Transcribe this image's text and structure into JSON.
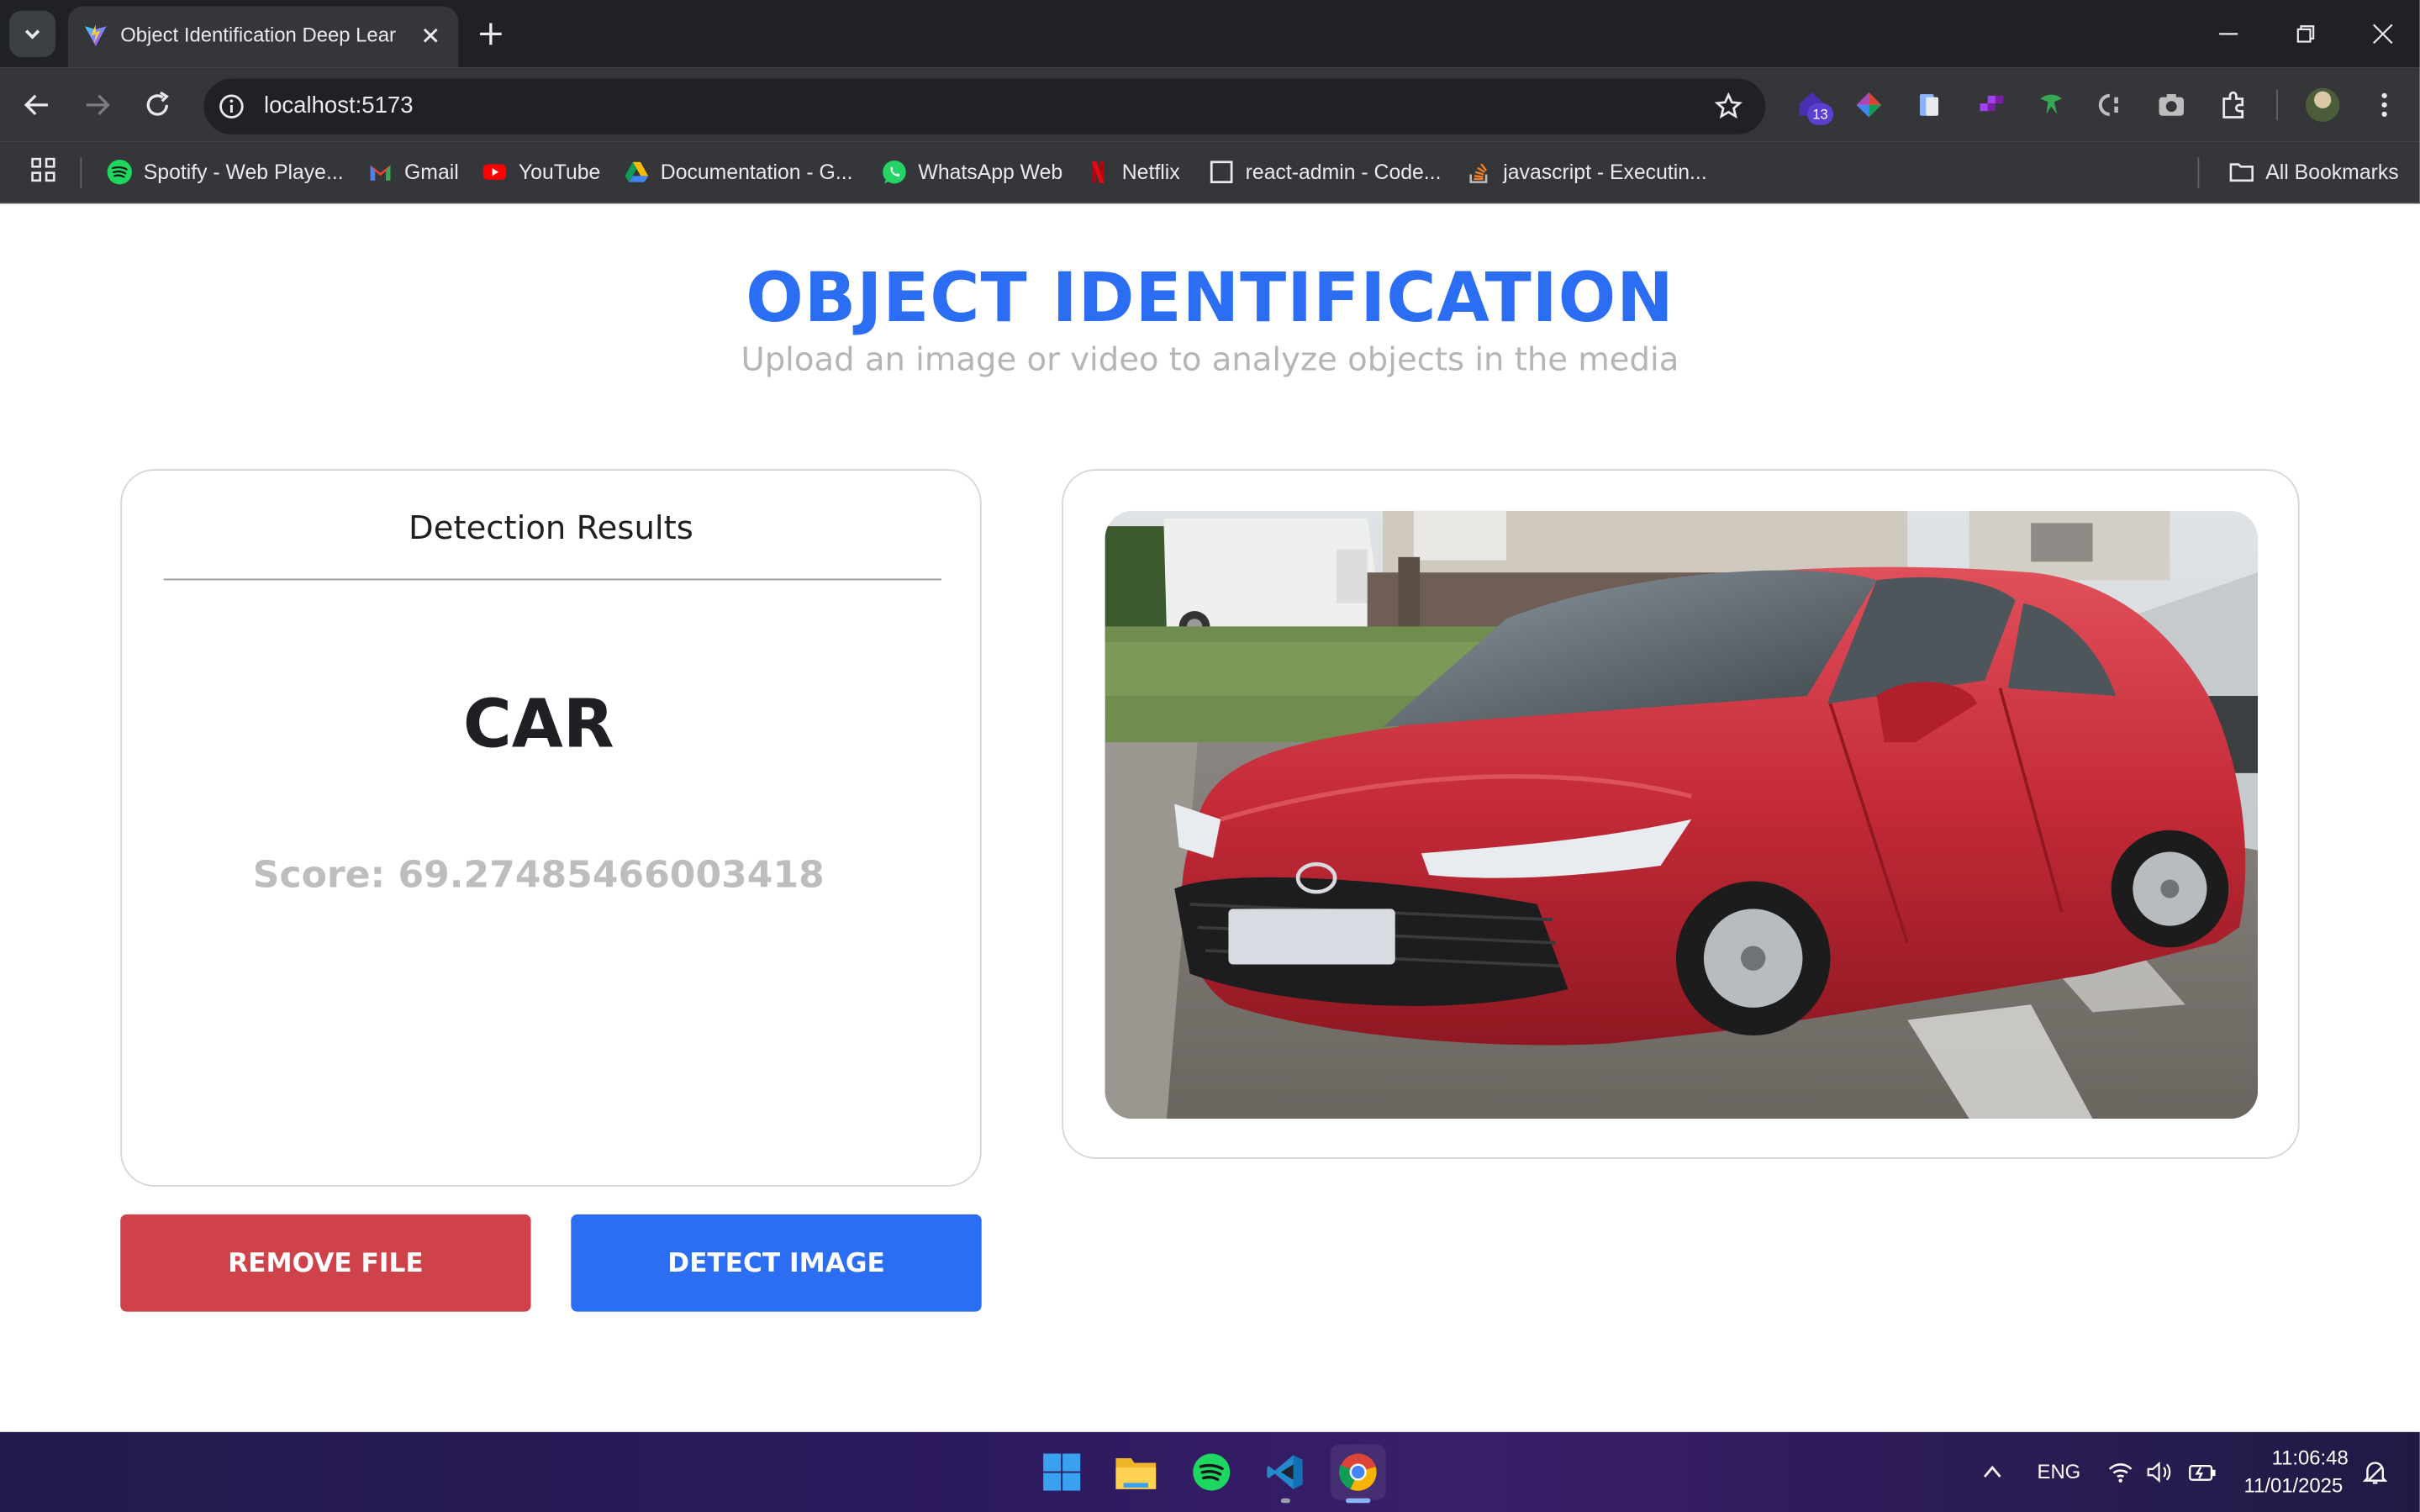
{
  "browser": {
    "tab_title": "Object Identification Deep Lear",
    "url": "localhost:5173",
    "extension_badge": "13",
    "bookmarks": [
      {
        "label": "Spotify - Web Playe...",
        "icon": "spotify-icon"
      },
      {
        "label": "Gmail",
        "icon": "gmail-icon"
      },
      {
        "label": "YouTube",
        "icon": "youtube-icon"
      },
      {
        "label": "Documentation - G...",
        "icon": "google-drive-icon"
      },
      {
        "label": "WhatsApp Web",
        "icon": "whatsapp-icon"
      },
      {
        "label": "Netflix",
        "icon": "netflix-icon"
      },
      {
        "label": "react-admin - Code...",
        "icon": "page-icon"
      },
      {
        "label": "javascript - Executin...",
        "icon": "stackoverflow-icon"
      }
    ],
    "all_bookmarks_label": "All Bookmarks"
  },
  "page": {
    "title": "OBJECT IDENTIFICATION",
    "subtitle": "Upload an image or video to analyze objects in the media",
    "results": {
      "heading": "Detection Results",
      "label": "CAR",
      "score": "Score: 69.27485466003418"
    },
    "buttons": {
      "remove": "REMOVE FILE",
      "detect": "DETECT IMAGE"
    },
    "colors": {
      "accent": "#2b6ef3",
      "danger": "#cf4249",
      "subtitle": "#b5b5b5"
    }
  },
  "taskbar": {
    "apps": [
      "windows-start-icon",
      "file-explorer-icon",
      "spotify-icon",
      "vscode-icon",
      "chrome-icon"
    ],
    "language": "ENG",
    "time": "11:06:48",
    "date": "11/01/2025"
  }
}
